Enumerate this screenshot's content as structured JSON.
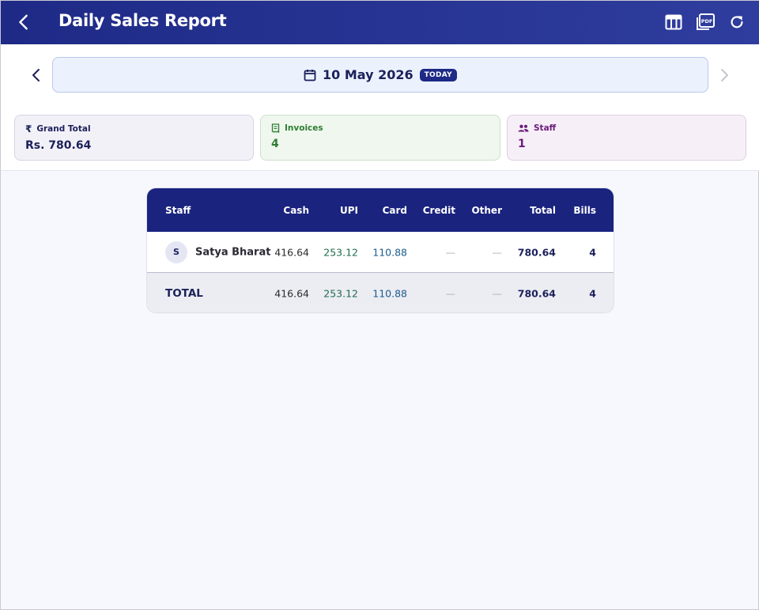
{
  "header": {
    "title": "Daily Sales Report",
    "back_icon": "arrow-back-icon",
    "actions": [
      "table-view-icon",
      "pdf-icon",
      "refresh-icon"
    ]
  },
  "date_nav": {
    "date": "10 May 2026",
    "badge": "TODAY"
  },
  "summary": {
    "grand_total": {
      "label": "Grand Total",
      "value": "Rs. 780.64"
    },
    "invoices": {
      "label": "Invoices",
      "value": "4"
    },
    "staff": {
      "label": "Staff",
      "value": "1"
    }
  },
  "table": {
    "headers": {
      "staff": "Staff",
      "cash": "Cash",
      "upi": "UPI",
      "card": "Card",
      "credit": "Credit",
      "other": "Other",
      "total": "Total",
      "bills": "Bills"
    },
    "rows": [
      {
        "initial": "S",
        "name": "Satya Bharat",
        "cash": "416.64",
        "upi": "253.12",
        "card": "110.88",
        "credit": "—",
        "other": "—",
        "total": "780.64",
        "bills": "4"
      }
    ],
    "totals": {
      "label": "TOTAL",
      "cash": "416.64",
      "upi": "253.12",
      "card": "110.88",
      "credit": "—",
      "other": "—",
      "total": "780.64",
      "bills": "4"
    }
  },
  "colors": {
    "primary": "#1a237e",
    "upi": "#1e6b4c",
    "card": "#1c5c8c"
  }
}
